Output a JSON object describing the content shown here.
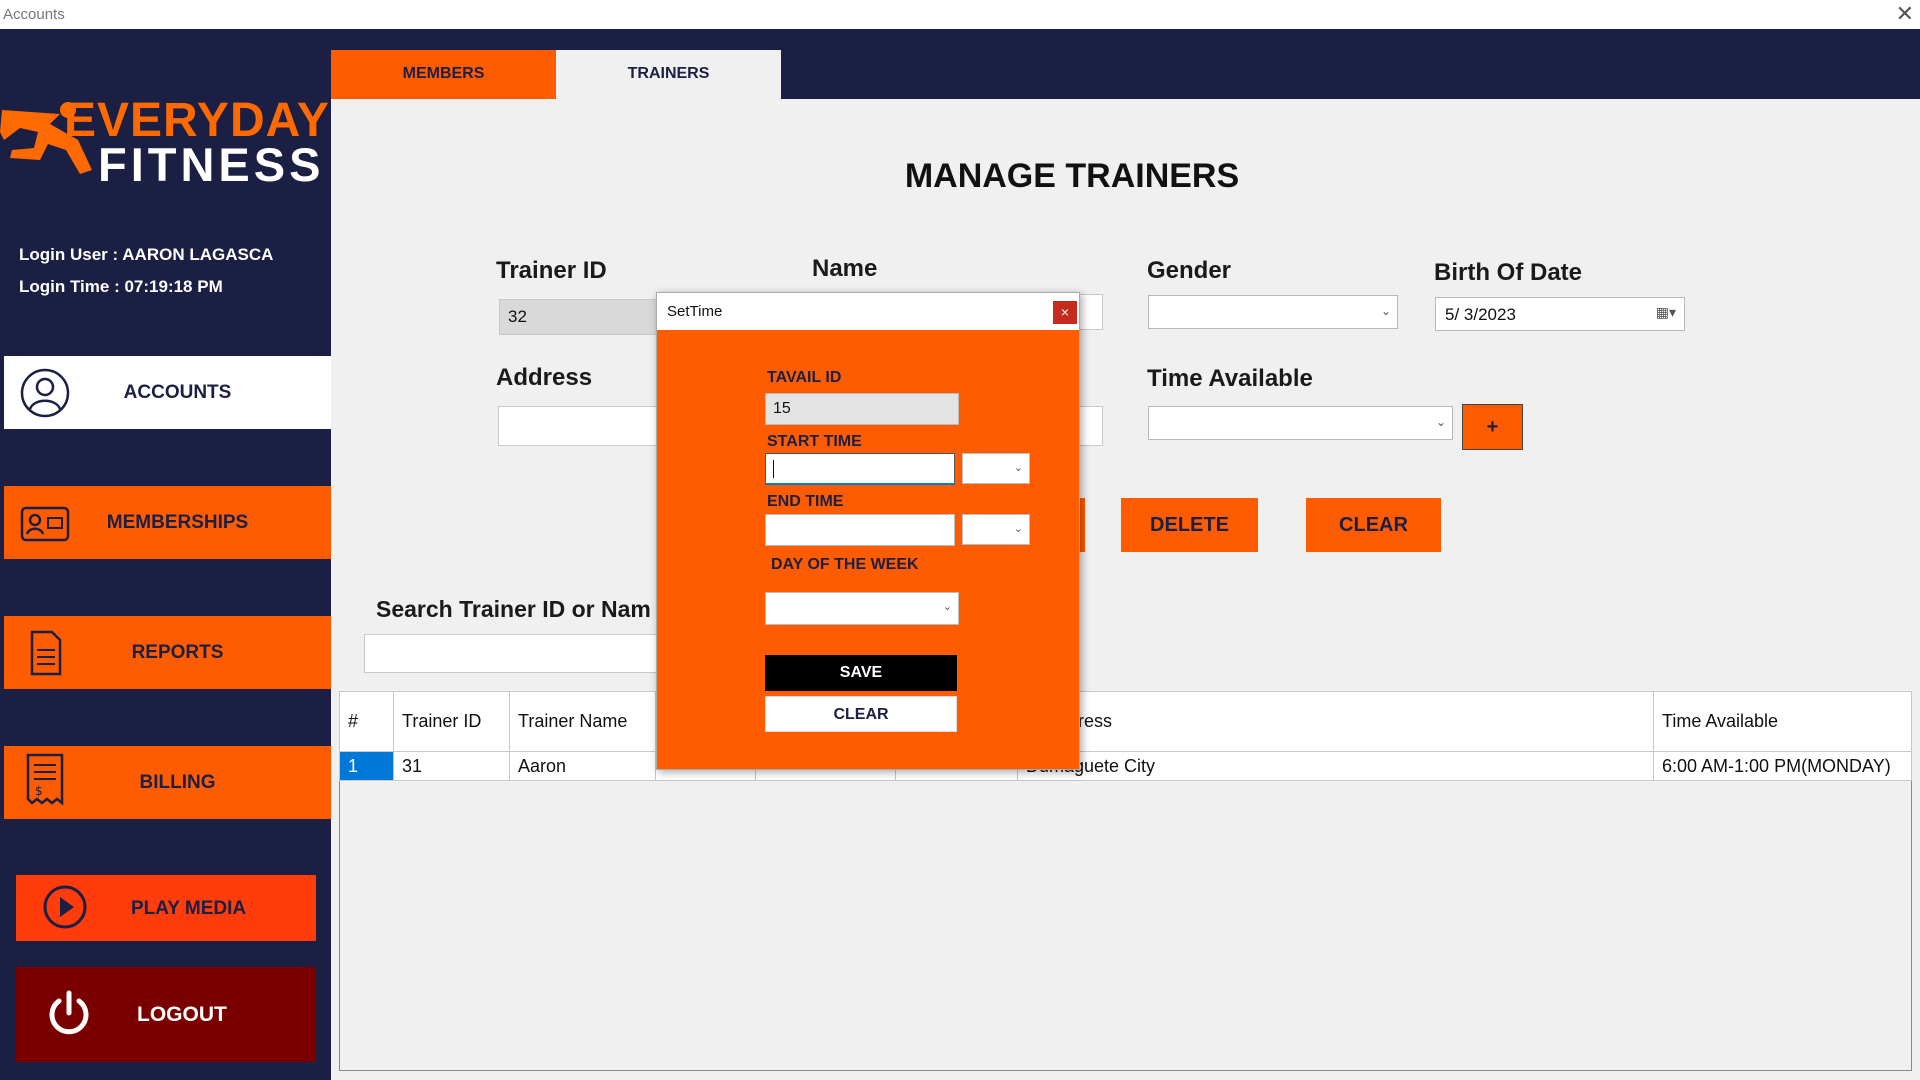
{
  "window": {
    "title": "Accounts",
    "close_glyph": "✕"
  },
  "logo": {
    "line1": "EVERYDAY",
    "line2": "FITNESS"
  },
  "login": {
    "user": "Login User : AARON LAGASCA",
    "time": "Login Time : 07:19:18 PM"
  },
  "sidebar": {
    "items": [
      {
        "label": "ACCOUNTS",
        "icon": "user-circle-icon",
        "active": true
      },
      {
        "label": "MEMBERSHIPS",
        "icon": "id-card-icon"
      },
      {
        "label": "REPORTS",
        "icon": "document-icon"
      },
      {
        "label": "BILLING",
        "icon": "receipt-icon"
      }
    ],
    "play_media": "PLAY MEDIA",
    "logout": "LOGOUT"
  },
  "tabs": {
    "members": "MEMBERS",
    "trainers": "TRAINERS"
  },
  "form": {
    "title": "MANAGE TRAINERS",
    "trainer_id_label": "Trainer ID",
    "trainer_id_value": "32",
    "name_label": "Name",
    "gender_label": "Gender",
    "birth_label": "Birth Of Date",
    "birth_value": "5/ 3/2023",
    "address_label": "Address",
    "time_available_label": "Time Available",
    "add_button": "+",
    "delete_button": "DELETE",
    "clear_button": "CLEAR",
    "search_label": "Search Trainer ID or Nam"
  },
  "table": {
    "headers": [
      "#",
      "Trainer ID",
      "Trainer Name",
      "",
      "",
      "",
      "er Address",
      "Time Available"
    ],
    "rows": [
      [
        "1",
        "31",
        "Aaron",
        "",
        "",
        "",
        "Dumaguete City",
        "6:00 AM-1:00 PM(MONDAY)"
      ]
    ]
  },
  "dialog": {
    "title": "SetTime",
    "close": "×",
    "tavail_label": "TAVAIL ID",
    "tavail_value": "15",
    "start_label": "START TIME",
    "start_value": "",
    "end_label": "END TIME",
    "end_value": "",
    "day_label": "DAY OF THE WEEK",
    "save": "SAVE",
    "clear": "CLEAR"
  },
  "colors": {
    "navy": "#1c1f44",
    "orange": "#ff5c00",
    "logout": "#7a0000",
    "selection": "#0078d7"
  }
}
